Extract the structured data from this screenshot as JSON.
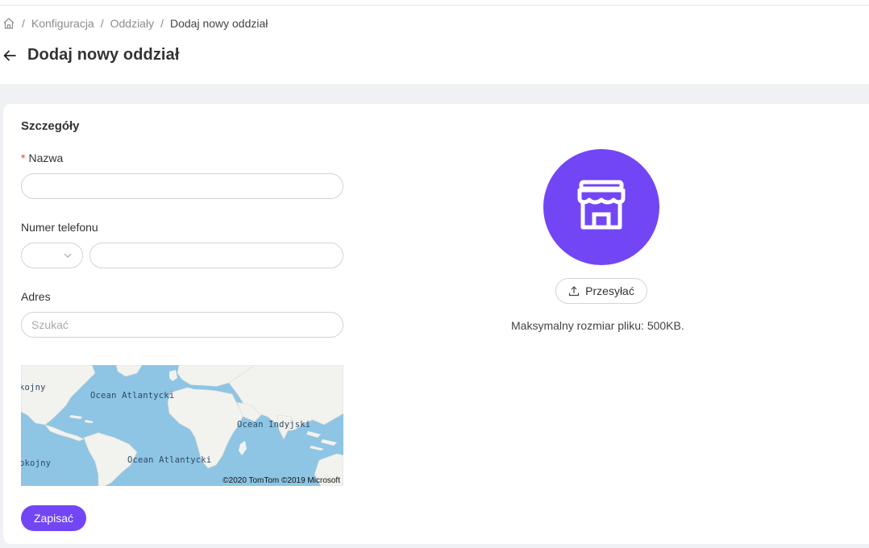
{
  "breadcrumb": {
    "items": [
      "Konfiguracja",
      "Oddziały"
    ],
    "current": "Dodaj nowy oddział"
  },
  "page": {
    "title": "Dodaj nowy oddział"
  },
  "form": {
    "section_title": "Szczegóły",
    "name": {
      "label": "Nazwa",
      "required_mark": "*",
      "value": "",
      "placeholder": ""
    },
    "phone": {
      "label": "Numer telefonu",
      "country_code": "",
      "value": "",
      "placeholder": ""
    },
    "address": {
      "label": "Adres",
      "value": "",
      "placeholder": "Szukać"
    },
    "map": {
      "labels": [
        "kojny",
        "Ocean Atlantycki",
        "Ocean Indyjski",
        "okojny",
        "Ocean Atlantycki"
      ],
      "credit": "©2020 TomTom ©2019 Microsoft"
    },
    "save_label": "Zapisać"
  },
  "image_upload": {
    "icon": "store-icon",
    "upload_label": "Przesyłać",
    "max_size_text": "Maksymalny rozmiar pliku: 500KB."
  },
  "colors": {
    "accent": "#7246f5",
    "background": "#f0f1f4",
    "required": "#e0453a",
    "map_water": "#8ec5e4",
    "map_land": "#f2f2ee"
  }
}
